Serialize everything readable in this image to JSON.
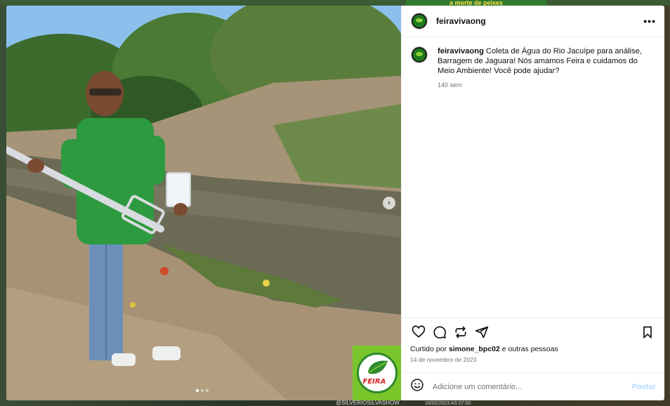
{
  "background": {
    "banner_text": "a morte de peixes",
    "watermark": "@SILVERIOSILVASHOW",
    "date_text": "18/02/2023 AS 07:00"
  },
  "post": {
    "username": "feiravivaong",
    "caption_user": "feiravivaong",
    "caption_text": "Coleta de Água do Rio Jacuípe para análise, Barragem de Jaguara! Nós amamos Feira e cuidamos do Meio Ambiente! Você pode ajudar?",
    "caption_age": "140 sem",
    "liked_by_prefix": "Curtido por",
    "liked_by_user": "simone_bpc02",
    "liked_by_suffix": "e outras pessoas",
    "date": "14 de novembro de 2023",
    "logo_text": "FEIRA"
  },
  "comment": {
    "placeholder": "Adicione um comentário...",
    "post_label": "Postar"
  },
  "icons": {
    "more": "more-options-icon",
    "like": "heart-icon",
    "comment": "comment-icon",
    "repost": "repost-icon",
    "share": "share-icon",
    "save": "bookmark-icon",
    "emoji": "emoji-icon",
    "next": "chevron-right-icon"
  },
  "carousel": {
    "total": 3,
    "current": 1
  },
  "colors": {
    "post_button": "#b3dbff",
    "brand_green": "#7ac52b"
  }
}
